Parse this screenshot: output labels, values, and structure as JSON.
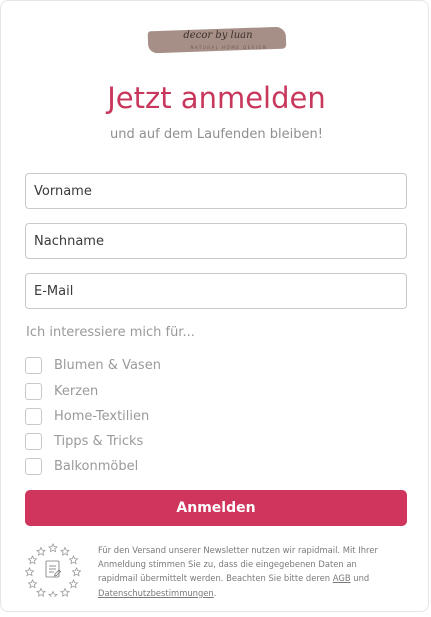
{
  "logo": {
    "script_text": "decor by luan",
    "tagline": "NATURAL HOME DESIGN"
  },
  "form": {
    "title": "Jetzt anmelden",
    "subtitle": "und auf dem Laufenden bleiben!",
    "fields": {
      "first_name_placeholder": "Vorname",
      "last_name_placeholder": "Nachname",
      "email_placeholder": "E-Mail"
    },
    "interests_label": "Ich interessiere mich für...",
    "interests": [
      {
        "label": "Blumen & Vasen",
        "checked": false
      },
      {
        "label": "Kerzen",
        "checked": false
      },
      {
        "label": "Home-Textilien",
        "checked": false
      },
      {
        "label": "Tipps & Tricks",
        "checked": false
      },
      {
        "label": "Balkonmöbel",
        "checked": false
      }
    ],
    "submit_label": "Anmelden"
  },
  "footer": {
    "text_before_agb": "Für den Versand unserer Newsletter nutzen wir rapidmail. Mit Ihrer Anmeldung stimmen Sie zu, dass die eingegebenen Daten an rapidmail übermittelt werden. Beachten Sie bitte deren ",
    "agb_link": "AGB",
    "text_between": " und ",
    "privacy_link": "Datenschutzbestimmungen",
    "text_after": "."
  },
  "colors": {
    "accent": "#d0365d",
    "title": "#c8385d",
    "muted_text": "#9a9a9a"
  },
  "icons": {
    "badge": "eu-stars-document-icon"
  }
}
